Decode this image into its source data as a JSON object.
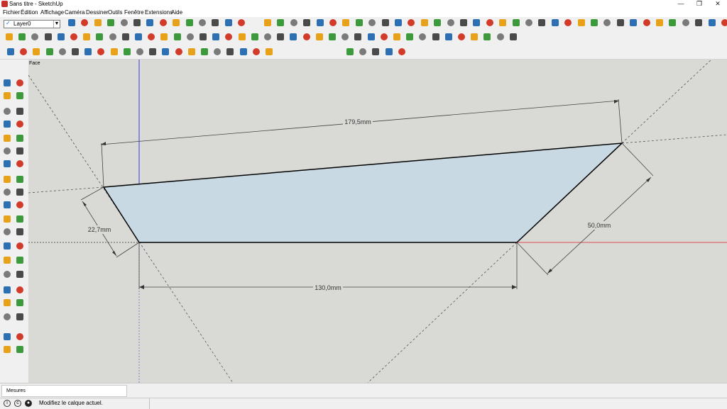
{
  "window": {
    "title": "Sans titre - SketchUp"
  },
  "menu": [
    "Fichier",
    "Édition",
    "Affichage",
    "Caméra",
    "Dessiner",
    "Outils",
    "Fenêtre",
    "Extensions",
    "Aide"
  ],
  "layer_selector": {
    "value": "Layer0"
  },
  "scene": {
    "tab_label": "Face"
  },
  "drawing": {
    "face_fill": "#c8d9e3",
    "dimensions": [
      "179,5mm",
      "22,7mm",
      "50,0mm",
      "130,0mm"
    ]
  },
  "measurements": {
    "label": "Mesures"
  },
  "status": {
    "text": "Modifiez le calque actuel."
  },
  "toolbar_colors": [
    "#2d6fb3",
    "#d23a2a",
    "#e8a21a",
    "#3c9a3c",
    "#7a7a7a",
    "#4a4a4a"
  ]
}
